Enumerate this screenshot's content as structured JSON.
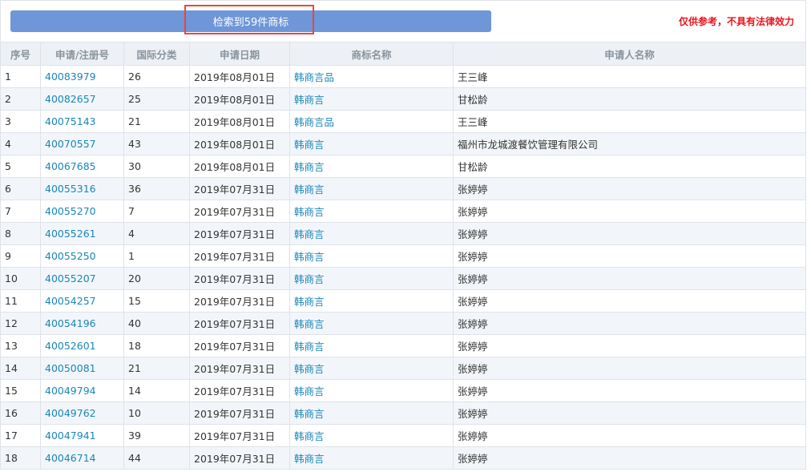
{
  "header": {
    "result_label": "检索到59件商标",
    "disclaimer": "仅供参考，不具有法律效力"
  },
  "table": {
    "columns": [
      "序号",
      "申请/注册号",
      "国际分类",
      "申请日期",
      "商标名称",
      "申请人名称"
    ],
    "rows": [
      {
        "no": "1",
        "reg": "40083979",
        "cls": "26",
        "date": "2019年08月01日",
        "name": "韩商言品",
        "applicant": "王三峰"
      },
      {
        "no": "2",
        "reg": "40082657",
        "cls": "25",
        "date": "2019年08月01日",
        "name": "韩商言",
        "applicant": "甘松龄"
      },
      {
        "no": "3",
        "reg": "40075143",
        "cls": "21",
        "date": "2019年08月01日",
        "name": "韩商言品",
        "applicant": "王三峰"
      },
      {
        "no": "4",
        "reg": "40070557",
        "cls": "43",
        "date": "2019年08月01日",
        "name": "韩商言",
        "applicant": "福州市龙城渡餐饮管理有限公司"
      },
      {
        "no": "5",
        "reg": "40067685",
        "cls": "30",
        "date": "2019年08月01日",
        "name": "韩商言",
        "applicant": "甘松龄"
      },
      {
        "no": "6",
        "reg": "40055316",
        "cls": "36",
        "date": "2019年07月31日",
        "name": "韩商言",
        "applicant": "张婷婷"
      },
      {
        "no": "7",
        "reg": "40055270",
        "cls": "7",
        "date": "2019年07月31日",
        "name": "韩商言",
        "applicant": "张婷婷"
      },
      {
        "no": "8",
        "reg": "40055261",
        "cls": "4",
        "date": "2019年07月31日",
        "name": "韩商言",
        "applicant": "张婷婷"
      },
      {
        "no": "9",
        "reg": "40055250",
        "cls": "1",
        "date": "2019年07月31日",
        "name": "韩商言",
        "applicant": "张婷婷"
      },
      {
        "no": "10",
        "reg": "40055207",
        "cls": "20",
        "date": "2019年07月31日",
        "name": "韩商言",
        "applicant": "张婷婷"
      },
      {
        "no": "11",
        "reg": "40054257",
        "cls": "15",
        "date": "2019年07月31日",
        "name": "韩商言",
        "applicant": "张婷婷"
      },
      {
        "no": "12",
        "reg": "40054196",
        "cls": "40",
        "date": "2019年07月31日",
        "name": "韩商言",
        "applicant": "张婷婷"
      },
      {
        "no": "13",
        "reg": "40052601",
        "cls": "18",
        "date": "2019年07月31日",
        "name": "韩商言",
        "applicant": "张婷婷"
      },
      {
        "no": "14",
        "reg": "40050081",
        "cls": "21",
        "date": "2019年07月31日",
        "name": "韩商言",
        "applicant": "张婷婷"
      },
      {
        "no": "15",
        "reg": "40049794",
        "cls": "14",
        "date": "2019年07月31日",
        "name": "韩商言",
        "applicant": "张婷婷"
      },
      {
        "no": "16",
        "reg": "40049762",
        "cls": "10",
        "date": "2019年07月31日",
        "name": "韩商言",
        "applicant": "张婷婷"
      },
      {
        "no": "17",
        "reg": "40047941",
        "cls": "39",
        "date": "2019年07月31日",
        "name": "韩商言",
        "applicant": "张婷婷"
      },
      {
        "no": "18",
        "reg": "40046714",
        "cls": "44",
        "date": "2019年07月31日",
        "name": "韩商言",
        "applicant": "张婷婷"
      }
    ]
  },
  "colors": {
    "accent_bar": "#6f96d8",
    "highlight_border": "#e8473d",
    "disclaimer_text": "#e8141c",
    "link": "#1a86b8",
    "header_bg": "#edf1f5",
    "row_alt_bg": "#f2f6fa"
  }
}
